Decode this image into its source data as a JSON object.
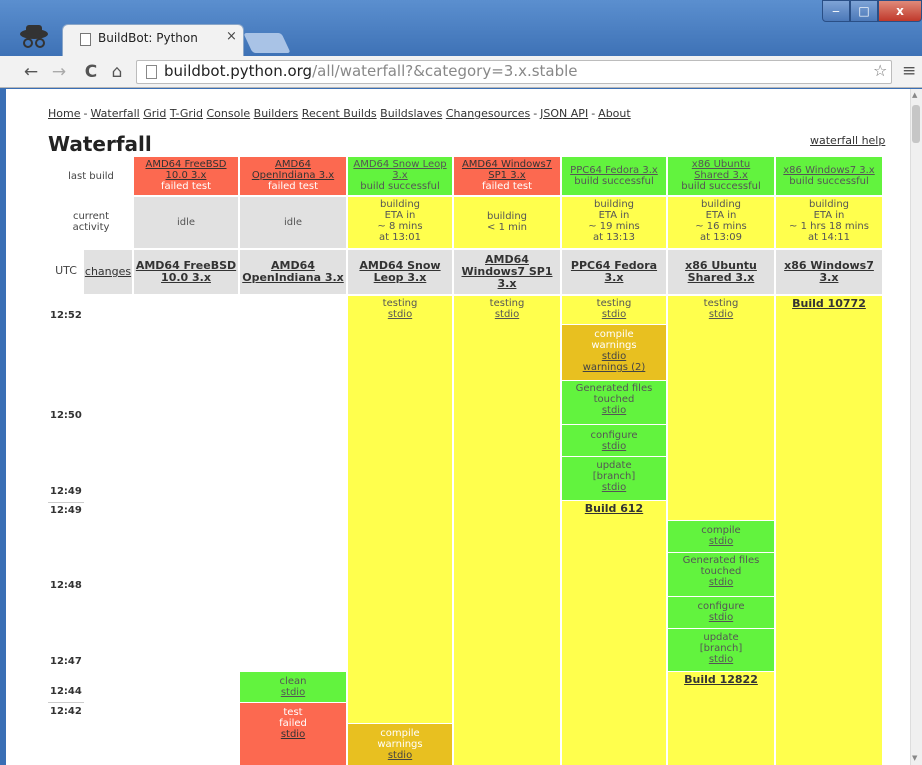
{
  "browser": {
    "tab_title": "BuildBot: Python",
    "tab_close": "×",
    "url_host": "buildbot.python.org",
    "url_rest": "/all/waterfall?&category=3.x.stable",
    "win_min": "‒",
    "win_max": "□",
    "win_close": "x",
    "back": "←",
    "forward": "→",
    "reload": "C",
    "home": "⌂",
    "star": "☆",
    "menu": "≡"
  },
  "nav": [
    "Home",
    "Waterfall",
    "Grid",
    "T-Grid",
    "Console",
    "Builders",
    "Recent Builds",
    "Buildslaves",
    "Changesources",
    "JSON API",
    "About"
  ],
  "nav_sep": "-",
  "heading": "Waterfall",
  "help_link": "waterfall help",
  "labels": {
    "last_build": "last build",
    "current_activity_1": "current",
    "current_activity_2": "activity",
    "utc": "UTC",
    "changes": "changes"
  },
  "colors": {
    "failed": "#fc6950",
    "success": "#62f33e",
    "building": "#ffff4d",
    "warnings": "#e8c020",
    "idle": "#e1e1e1"
  },
  "builders": [
    {
      "last_lines": [
        "AMD64 FreeBSD",
        "10.0 3.x"
      ],
      "last_status": "failed test",
      "activity": [
        "idle"
      ],
      "header": [
        "AMD64 FreeBSD",
        "10.0 3.x"
      ]
    },
    {
      "last_lines": [
        "AMD64",
        "OpenIndiana 3.x"
      ],
      "last_status": "failed test",
      "activity": [
        "idle"
      ],
      "header": [
        "AMD64",
        "OpenIndiana 3.x"
      ]
    },
    {
      "last_lines": [
        "AMD64 Snow Leop",
        "3.x"
      ],
      "last_status": "build successful",
      "activity": [
        "building",
        "ETA in",
        "~ 8 mins",
        "at 13:01"
      ],
      "header": [
        "AMD64 Snow",
        "Leop 3.x"
      ]
    },
    {
      "last_lines": [
        "AMD64 Windows7",
        "SP1 3.x"
      ],
      "last_status": "failed test",
      "activity": [
        "building",
        "< 1 min"
      ],
      "header": [
        "AMD64",
        "Windows7 SP1",
        "3.x"
      ]
    },
    {
      "last_lines": [
        "PPC64 Fedora 3.x"
      ],
      "last_status": "build successful",
      "activity": [
        "building",
        "ETA in",
        "~ 19 mins",
        "at 13:13"
      ],
      "header": [
        "PPC64 Fedora",
        "3.x"
      ]
    },
    {
      "last_lines": [
        "x86 Ubuntu",
        "Shared 3.x"
      ],
      "last_status": "build successful",
      "activity": [
        "building",
        "ETA in",
        "~ 16 mins",
        "at 13:09"
      ],
      "header": [
        "x86 Ubuntu",
        "Shared 3.x"
      ]
    },
    {
      "last_lines": [
        "x86 Windows7 3.x"
      ],
      "last_status": "build successful",
      "activity": [
        "building",
        "ETA in",
        "~ 1 hrs 18 mins",
        "at 14:11"
      ],
      "header": [
        "x86 Windows7",
        "3.x"
      ]
    }
  ],
  "times": [
    "12:52",
    "12:50",
    "12:49",
    "12:49",
    "12:48",
    "12:47",
    "12:44",
    "12:42"
  ],
  "steps": {
    "testing": "testing",
    "stdio": "stdio",
    "compile": "compile",
    "warnings": "warnings",
    "warnings_2": "warnings (2)",
    "generated": "Generated files",
    "touched": "touched",
    "configure": "configure",
    "update": "update",
    "branch": "[branch]",
    "clean": "clean",
    "test": "test",
    "failed": "failed"
  },
  "builds": {
    "ppc": "Build 612",
    "x86u": "Build 12822",
    "x86w": "Build 10772"
  }
}
